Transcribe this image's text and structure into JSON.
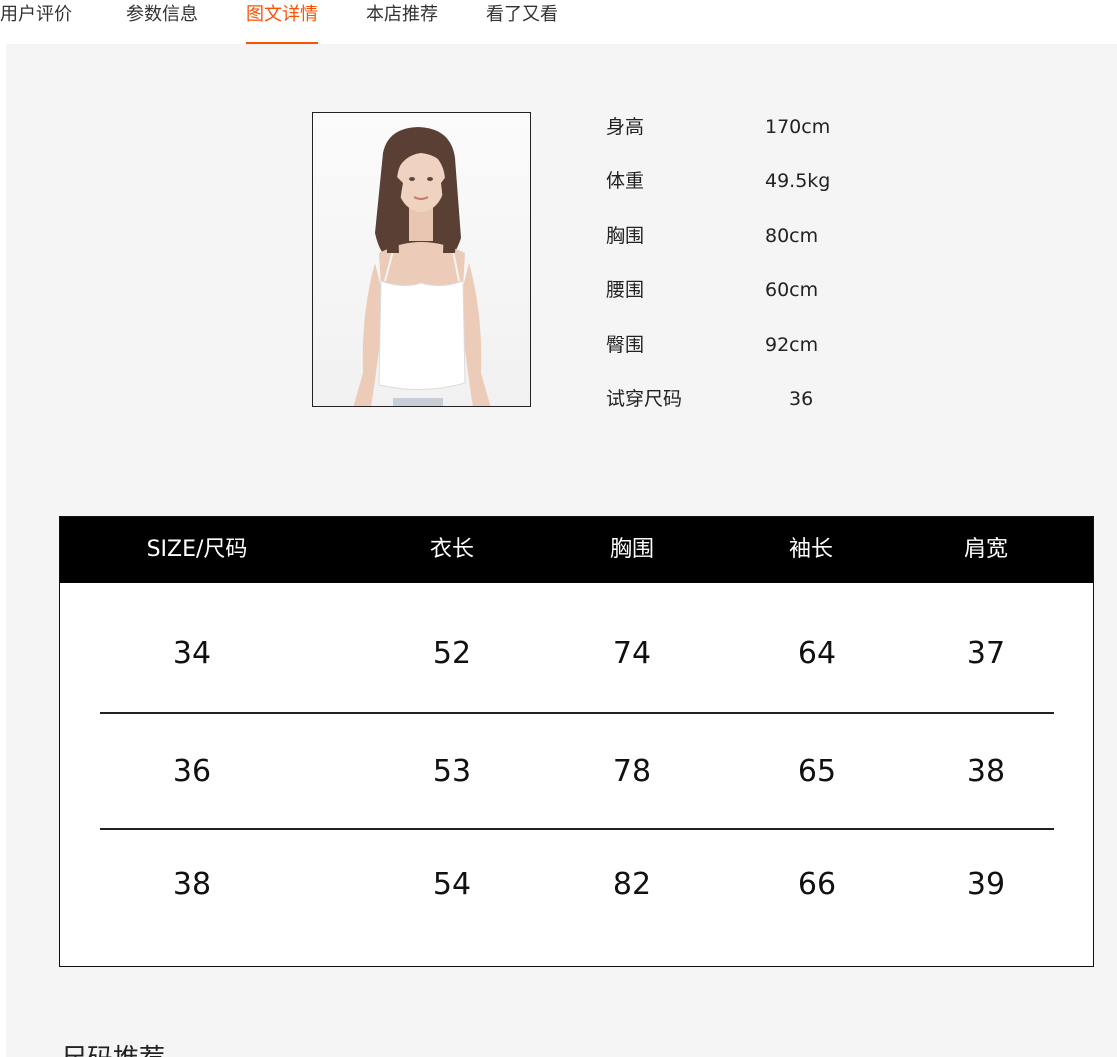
{
  "tabs": [
    {
      "label": "用户评价",
      "active": false
    },
    {
      "label": "参数信息",
      "active": false
    },
    {
      "label": "图文详情",
      "active": true
    },
    {
      "label": "本店推荐",
      "active": false
    },
    {
      "label": "看了又看",
      "active": false
    }
  ],
  "model": {
    "specs": [
      {
        "label": "身高",
        "value": "170cm"
      },
      {
        "label": "体重",
        "value": "49.5kg"
      },
      {
        "label": "胸围",
        "value": "80cm"
      },
      {
        "label": "腰围",
        "value": "60cm"
      },
      {
        "label": "臀围",
        "value": "92cm"
      },
      {
        "label": "试穿尺码",
        "value": "36"
      }
    ]
  },
  "size_table": {
    "headers": [
      "SIZE/尺码",
      "衣长",
      "胸围",
      "袖长",
      "肩宽"
    ],
    "rows": [
      [
        "34",
        "52",
        "74",
        "64",
        "37"
      ],
      [
        "36",
        "53",
        "78",
        "65",
        "38"
      ],
      [
        "38",
        "54",
        "82",
        "66",
        "39"
      ]
    ]
  },
  "section": {
    "title": "尺码推荐"
  },
  "colors": {
    "accent": "#ff5000",
    "table_header_bg": "#000000",
    "content_bg": "#f5f5f5"
  }
}
